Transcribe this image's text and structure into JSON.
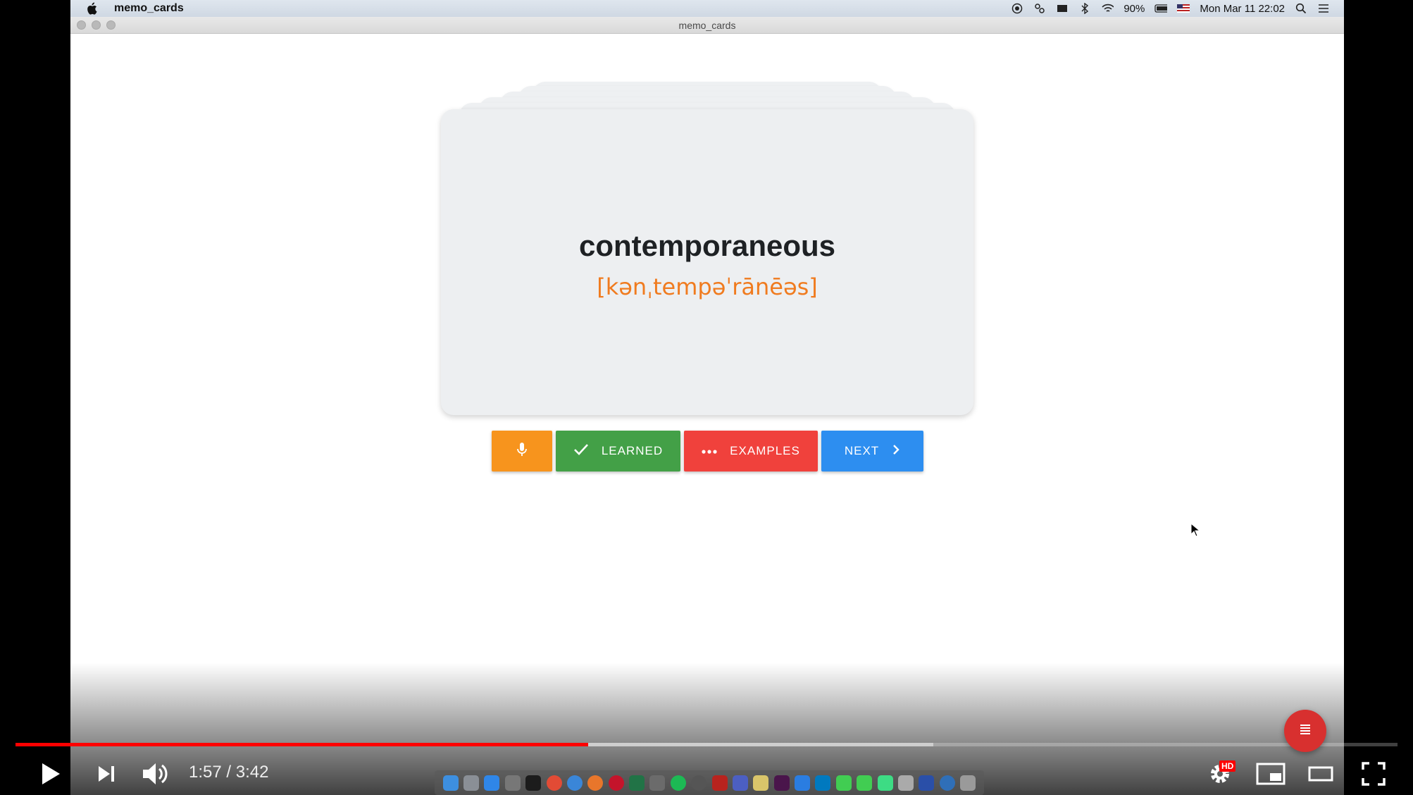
{
  "menubar": {
    "app_name": "memo_cards",
    "battery": "90%",
    "datetime": "Mon Mar 11  22:02"
  },
  "window": {
    "title": "memo_cards"
  },
  "card": {
    "word": "contemporaneous",
    "phonetic": "[kənˌtempəˈrānēəs]"
  },
  "buttons": {
    "learned": "LEARNED",
    "examples": "EXAMPLES",
    "next": "NEXT"
  },
  "player": {
    "time": "1:57 / 3:42",
    "progress_played": 0.4144,
    "progress_buffered": 0.664,
    "quality_badge": "HD"
  },
  "colors": {
    "mic": "#f7941d",
    "learned": "#43a047",
    "examples": "#f0413c",
    "next": "#2d8ef0",
    "phonetic": "#f07b1f"
  }
}
